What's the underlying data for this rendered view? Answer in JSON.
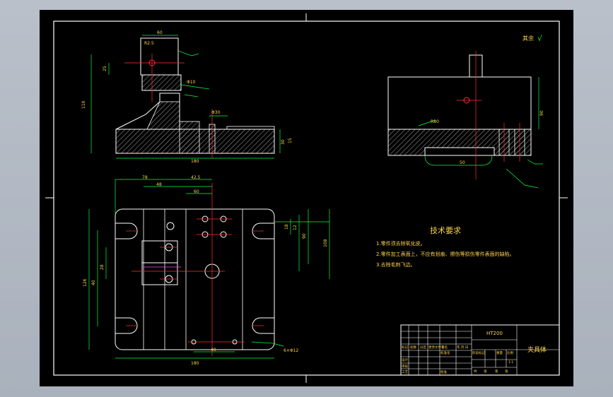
{
  "drawing": {
    "roughness_note": "其余",
    "roughness_symbol": "√",
    "tech_req": {
      "title": "技术要求",
      "items": [
        "1.零件须去除氧化皮。",
        "2.零件加工表面上，不应有划痕、擦伤等损伤零件表面的缺陷。",
        "3.去除毛刺飞边。"
      ]
    },
    "title_block": {
      "material": "HT200",
      "part_name": "夹具体",
      "scale": "1:1",
      "sheet": "1",
      "labels": {
        "mark": "标记",
        "count": "处数",
        "zone": "分区",
        "doc": "更改文件号",
        "sign": "签名",
        "date": "年.月.日",
        "design": "设计",
        "standard": "标准化",
        "stage": "阶段标记",
        "weight": "重量",
        "scale_label": "比例",
        "review": "审核",
        "craft": "工艺",
        "approve": "批准",
        "total": "共",
        "zhang": "张",
        "di": "第"
      }
    },
    "dims": {
      "front_w": "60",
      "front_h": "110",
      "front_d1": "R2.5",
      "front_d2": "25",
      "front_base": "180",
      "front_r": "30",
      "front_t": "15",
      "front_phi": "Φ30",
      "front_f1": "Φ10",
      "side_w": "50",
      "side_h": "90",
      "side_r": "R80",
      "top_w": "180",
      "top_h": "150",
      "top_a": "78",
      "top_b": "42.5",
      "top_c": "48",
      "top_d": "60",
      "top_e": "126",
      "top_f": "40",
      "top_g": "28",
      "top_r1": "18",
      "top_r2": "12",
      "top_r3": "90",
      "top_r4": "108",
      "top_bot": "158",
      "top_bot2": "40",
      "top_phi": "6×Φ12"
    }
  }
}
